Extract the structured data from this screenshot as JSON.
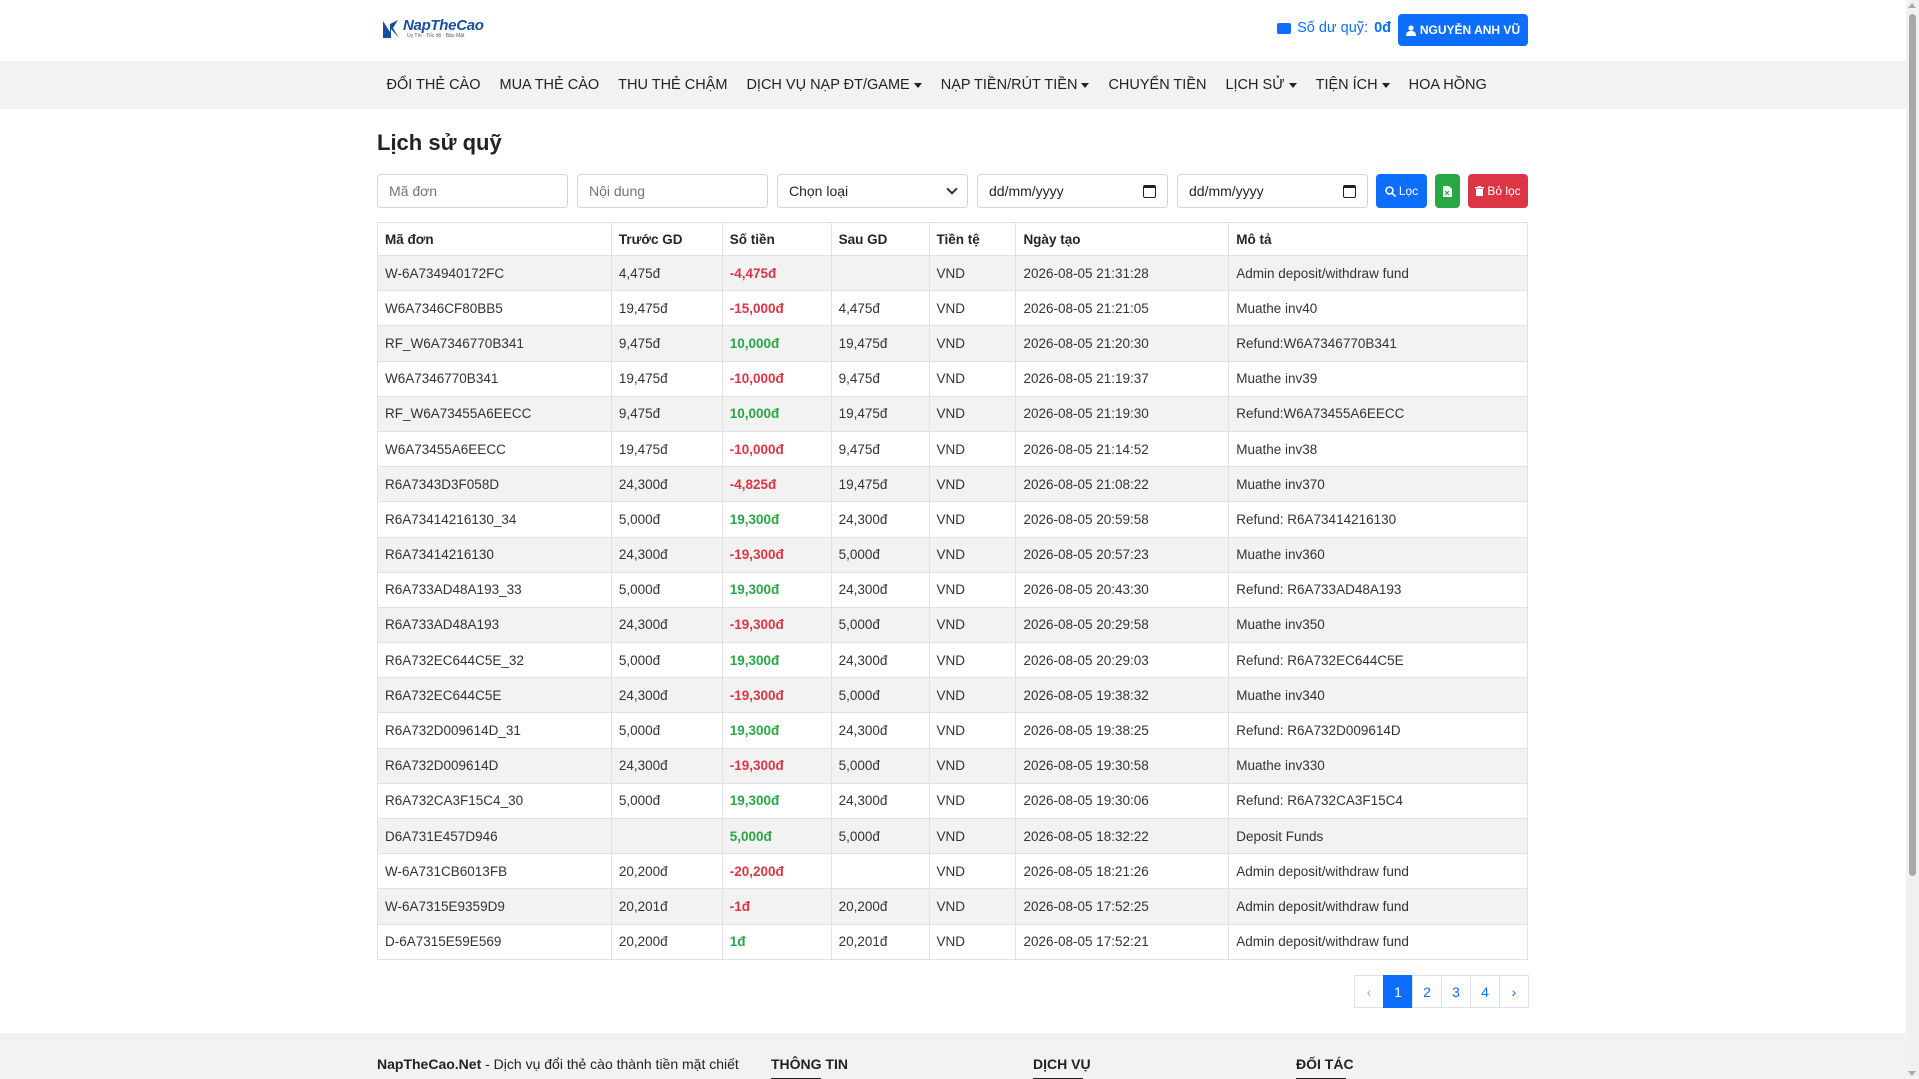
{
  "header": {
    "logo_text": "NapTheCao",
    "logo_sub": "Uy Tín · Tốc độ · Bảo Mật",
    "balance_label": "Số dư quỹ:",
    "balance_value": "0đ",
    "user_name": "NGUYỄN ANH VŨ"
  },
  "nav": {
    "items": [
      {
        "label": "ĐỔI THẺ CÀO",
        "dropdown": false
      },
      {
        "label": "MUA THẺ CÀO",
        "dropdown": false
      },
      {
        "label": "THU THẺ CHẬM",
        "dropdown": false
      },
      {
        "label": "DỊCH VỤ NẠP ĐT/GAME",
        "dropdown": true
      },
      {
        "label": "NẠP TIỀN/RÚT TIỀN",
        "dropdown": true
      },
      {
        "label": "CHUYỂN TIỀN",
        "dropdown": false
      },
      {
        "label": "LỊCH SỬ",
        "dropdown": true
      },
      {
        "label": "TIỆN ÍCH",
        "dropdown": true
      },
      {
        "label": "HOA HỒNG",
        "dropdown": false
      }
    ]
  },
  "page": {
    "title": "Lịch sử quỹ"
  },
  "filters": {
    "order_placeholder": "Mã đơn",
    "content_placeholder": "Nội dung",
    "type_selected": "Chọn loại",
    "date_from": "dd/mm/yyyy",
    "date_to": "dd/mm/yyyy",
    "filter_label": "Lọc",
    "clear_label": "Bỏ lọc"
  },
  "table": {
    "headers": [
      "Mã đơn",
      "Trước GD",
      "Số tiền",
      "Sau GD",
      "Tiền tệ",
      "Ngày tạo",
      "Mô tả"
    ],
    "rows": [
      {
        "id": "W-6A734940172FC",
        "before": "4,475đ",
        "amount": "-4,475đ",
        "sign": "neg",
        "after": "",
        "currency": "VND",
        "created": "2026-08-05 21:31:28",
        "desc": "Admin deposit/withdraw fund"
      },
      {
        "id": "W6A7346CF80BB5",
        "before": "19,475đ",
        "amount": "-15,000đ",
        "sign": "neg",
        "after": "4,475đ",
        "currency": "VND",
        "created": "2026-08-05 21:21:05",
        "desc": "Muathe inv40"
      },
      {
        "id": "RF_W6A7346770B341",
        "before": "9,475đ",
        "amount": "10,000đ",
        "sign": "pos",
        "after": "19,475đ",
        "currency": "VND",
        "created": "2026-08-05 21:20:30",
        "desc": "Refund:W6A7346770B341"
      },
      {
        "id": "W6A7346770B341",
        "before": "19,475đ",
        "amount": "-10,000đ",
        "sign": "neg",
        "after": "9,475đ",
        "currency": "VND",
        "created": "2026-08-05 21:19:37",
        "desc": "Muathe inv39"
      },
      {
        "id": "RF_W6A73455A6EECC",
        "before": "9,475đ",
        "amount": "10,000đ",
        "sign": "pos",
        "after": "19,475đ",
        "currency": "VND",
        "created": "2026-08-05 21:19:30",
        "desc": "Refund:W6A73455A6EECC"
      },
      {
        "id": "W6A73455A6EECC",
        "before": "19,475đ",
        "amount": "-10,000đ",
        "sign": "neg",
        "after": "9,475đ",
        "currency": "VND",
        "created": "2026-08-05 21:14:52",
        "desc": "Muathe inv38"
      },
      {
        "id": "R6A7343D3F058D",
        "before": "24,300đ",
        "amount": "-4,825đ",
        "sign": "neg",
        "after": "19,475đ",
        "currency": "VND",
        "created": "2026-08-05 21:08:22",
        "desc": "Muathe inv370"
      },
      {
        "id": "R6A73414216130_34",
        "before": "5,000đ",
        "amount": "19,300đ",
        "sign": "pos",
        "after": "24,300đ",
        "currency": "VND",
        "created": "2026-08-05 20:59:58",
        "desc": "Refund: R6A73414216130"
      },
      {
        "id": "R6A73414216130",
        "before": "24,300đ",
        "amount": "-19,300đ",
        "sign": "neg",
        "after": "5,000đ",
        "currency": "VND",
        "created": "2026-08-05 20:57:23",
        "desc": "Muathe inv360"
      },
      {
        "id": "R6A733AD48A193_33",
        "before": "5,000đ",
        "amount": "19,300đ",
        "sign": "pos",
        "after": "24,300đ",
        "currency": "VND",
        "created": "2026-08-05 20:43:30",
        "desc": "Refund: R6A733AD48A193"
      },
      {
        "id": "R6A733AD48A193",
        "before": "24,300đ",
        "amount": "-19,300đ",
        "sign": "neg",
        "after": "5,000đ",
        "currency": "VND",
        "created": "2026-08-05 20:29:58",
        "desc": "Muathe inv350"
      },
      {
        "id": "R6A732EC644C5E_32",
        "before": "5,000đ",
        "amount": "19,300đ",
        "sign": "pos",
        "after": "24,300đ",
        "currency": "VND",
        "created": "2026-08-05 20:29:03",
        "desc": "Refund: R6A732EC644C5E"
      },
      {
        "id": "R6A732EC644C5E",
        "before": "24,300đ",
        "amount": "-19,300đ",
        "sign": "neg",
        "after": "5,000đ",
        "currency": "VND",
        "created": "2026-08-05 19:38:32",
        "desc": "Muathe inv340"
      },
      {
        "id": "R6A732D009614D_31",
        "before": "5,000đ",
        "amount": "19,300đ",
        "sign": "pos",
        "after": "24,300đ",
        "currency": "VND",
        "created": "2026-08-05 19:38:25",
        "desc": "Refund: R6A732D009614D"
      },
      {
        "id": "R6A732D009614D",
        "before": "24,300đ",
        "amount": "-19,300đ",
        "sign": "neg",
        "after": "5,000đ",
        "currency": "VND",
        "created": "2026-08-05 19:30:58",
        "desc": "Muathe inv330"
      },
      {
        "id": "R6A732CA3F15C4_30",
        "before": "5,000đ",
        "amount": "19,300đ",
        "sign": "pos",
        "after": "24,300đ",
        "currency": "VND",
        "created": "2026-08-05 19:30:06",
        "desc": "Refund: R6A732CA3F15C4"
      },
      {
        "id": "D6A731E457D946",
        "before": "",
        "amount": "5,000đ",
        "sign": "pos",
        "after": "5,000đ",
        "currency": "VND",
        "created": "2026-08-05 18:32:22",
        "desc": "Deposit Funds"
      },
      {
        "id": "W-6A731CB6013FB",
        "before": "20,200đ",
        "amount": "-20,200đ",
        "sign": "neg",
        "after": "",
        "currency": "VND",
        "created": "2026-08-05 18:21:26",
        "desc": "Admin deposit/withdraw fund"
      },
      {
        "id": "W-6A7315E9359D9",
        "before": "20,201đ",
        "amount": "-1đ",
        "sign": "neg",
        "after": "20,200đ",
        "currency": "VND",
        "created": "2026-08-05 17:52:25",
        "desc": "Admin deposit/withdraw fund"
      },
      {
        "id": "D-6A7315E59E569",
        "before": "20,200đ",
        "amount": "1đ",
        "sign": "pos",
        "after": "20,201đ",
        "currency": "VND",
        "created": "2026-08-05 17:52:21",
        "desc": "Admin deposit/withdraw fund"
      }
    ]
  },
  "pagination": {
    "prev": "‹",
    "next": "›",
    "pages": [
      "1",
      "2",
      "3",
      "4"
    ],
    "current": "1"
  },
  "footer": {
    "brand_name": "NapTheCao.Net",
    "brand_tagline": " - Dịch vụ đổi thẻ cào thành tiền mặt chiết",
    "col_info": "THÔNG TIN",
    "col_service": "DỊCH VỤ",
    "col_partner": "ĐỐI TÁC"
  },
  "colors": {
    "primary": "#0d6efd",
    "success": "#28a745",
    "danger": "#dc3545",
    "nav_bg": "#f2f2f3"
  }
}
